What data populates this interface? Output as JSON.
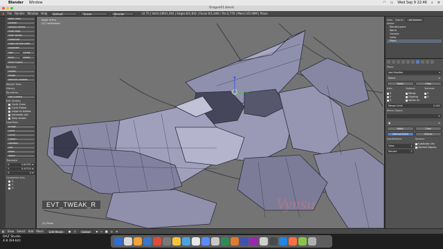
{
  "macbar": {
    "apple": "",
    "menus": [
      "Blender",
      "Window"
    ],
    "clock": "Wed Sep 9  22:46"
  },
  "window": {
    "title": "Dragon01.blend"
  },
  "infobar": {
    "menus": [
      "File",
      "Render",
      "Window",
      "Help"
    ],
    "layout": "Default",
    "scene": "Scene",
    "engine": "Blender Render",
    "stats": "v2.75 | Verts:280/1,392 | Edges:0/2,832 | Faces:0/1,448 | Tris:2,776 | Mem:145.96M | Plane"
  },
  "toolshelf": {
    "buttons1": [
      "Mesh Tools",
      "Deform",
      "Smooth Vertex",
      "Slide Edge",
      "Slide Vertex",
      "Subdivide",
      "Loop Cut and Slide",
      "Duplicate",
      "Spin",
      "Screw",
      "Knife",
      "Select",
      "Knife Project"
    ],
    "head_remove": "Remove:",
    "buttons2": [
      "Delete",
      "Merge",
      "Remove Doubles"
    ],
    "head_weight": "Weight Tools",
    "head_history": "History",
    "head_bsurfaces": "Bsurfaces",
    "buttons3": [
      "Add Surface",
      "Edit Strokes"
    ],
    "checks": [
      "Cyclic Cross",
      "Cyclic Follow",
      "Loops on strokes",
      "Automatic join",
      "Keep strokes"
    ],
    "head_looptools": "LoopTools",
    "buttons4": [
      "Bridge",
      "Circle",
      "Curve",
      "Flatten",
      "Gstretch",
      "Loft",
      "Relax",
      "Space"
    ],
    "head_translate": "Translate",
    "fields": [
      {
        "label": "X:",
        "value": "0.84765 m"
      },
      {
        "label": "Y:",
        "value": "0.44754 m"
      },
      {
        "label": "Z:",
        "value": "0 m"
      }
    ],
    "head_constraint": "Constraint Axis",
    "axis": [
      "X",
      "Y",
      "Z"
    ]
  },
  "viewport": {
    "label_line1": "Right Ortho",
    "label_line2": "(2) Corfinished",
    "keycast": "EVT_TWEAK_R",
    "watermark": "Vynsu",
    "object": "(2) Plane"
  },
  "outliner": {
    "view": "View",
    "search": "Search",
    "scenes": "All Scenes",
    "rows": [
      "Scene",
      "RenderLayers",
      "World",
      "Camera",
      "Lamp",
      "Plane"
    ]
  },
  "props": {
    "object_name": "Plane",
    "add_modifier": "Add Modifier",
    "modifier_name": "Mirror",
    "apply": "Apply",
    "copy": "Copy",
    "axis_label": "Axis:",
    "options_label": "Options:",
    "textures_label": "Textures:",
    "axis_checks": [
      "X",
      "Y",
      "Z"
    ],
    "option_checks": [
      "Merge",
      "Clipping",
      "Vertex Gr"
    ],
    "texture_checks": [
      "U",
      "V"
    ],
    "merge_limit_label": "Merge Limit:",
    "merge_limit_value": "0.001",
    "mirror_object_label": "Mirror Object:",
    "sub_apply": "Apply",
    "sub_copy": "Copy",
    "tab_catmull": "Catmull-Clark",
    "tab_simple": "Simple",
    "subdivisions_label": "Subdivisions:",
    "view_label": "View:",
    "view_value": "1",
    "render_label": "Render:",
    "render_value": "2",
    "sub_options_label": "Options:",
    "sub_checks": [
      "Subdivide UVs",
      "Optimal Display"
    ]
  },
  "bottombar": {
    "items": [
      "View",
      "Select",
      "Add",
      "Mesh"
    ],
    "mode": "Edit Mode",
    "pivot": "Global"
  },
  "dock": {
    "app_name": "DAZ Studio",
    "version": "4.8 (64-bit)",
    "icon_colors": [
      "#2c6fd6",
      "#d9d9d9",
      "#f2a33a",
      "#3a77c7",
      "#e04b3b",
      "#7a7a7a",
      "#f4c542",
      "#4aa3e0",
      "#e8e8e8",
      "#5b8cff",
      "#c8c8c8",
      "#2e8b57",
      "#e07a2e",
      "#3f51b5",
      "#9c27b0",
      "#cfcfcf",
      "#4a4a4a",
      "#1e88e5",
      "#ff7043",
      "#8bc34a",
      "#b0b0b0"
    ]
  },
  "colors": {
    "viewport": "#747474",
    "mesh_fill": "#9a9ab6",
    "mesh_dark": "#3c3c50",
    "watermark": "#d07878",
    "selection_tab": "#5680c2"
  }
}
